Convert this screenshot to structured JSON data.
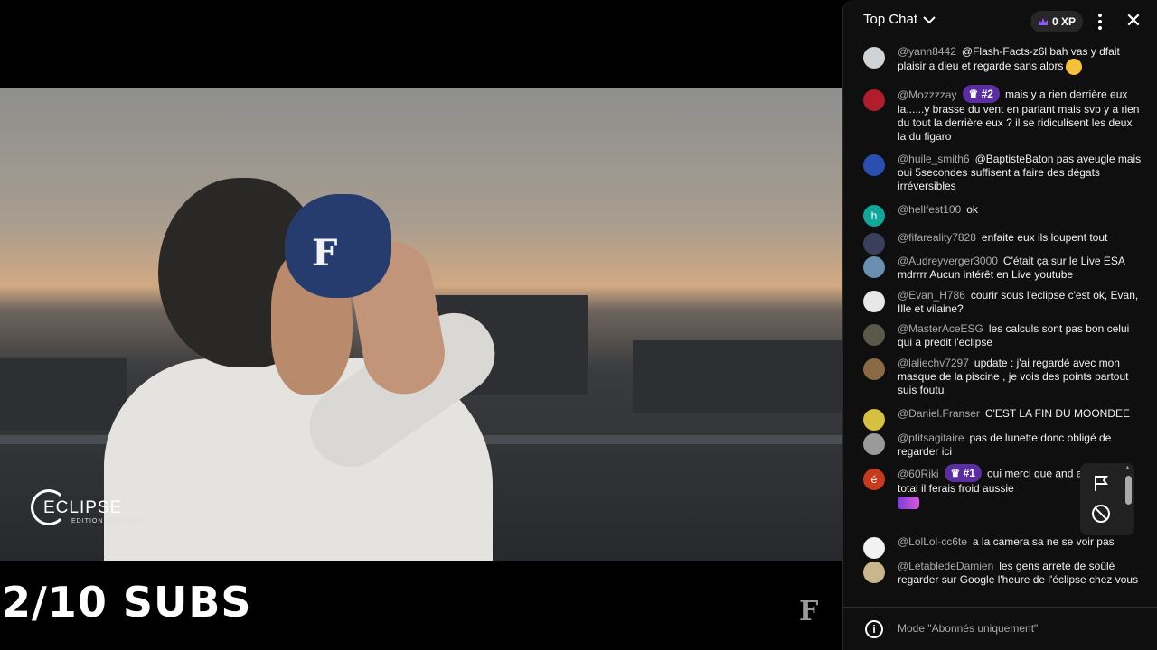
{
  "video": {
    "overlay_logo_text": "ECLIPSE",
    "overlay_logo_subtitle": "EDITION SPECIALE",
    "subs_counter": "2/10 SUBS",
    "brand_mark": "F"
  },
  "chat": {
    "title": "Top Chat",
    "xp_label": "0 XP",
    "footer_text": "Mode \"Abonnés uniquement\"",
    "messages": [
      {
        "author": "@yann8442",
        "text": "@Flash-Facts-z6l bah vas y dfait plaisir a dieu et regarde sans alors",
        "avatar_color": "#cfd3d6",
        "avatar_letter": ""
      },
      {
        "author": "@Mozzzzay",
        "rank": "#2",
        "text": "mais y a rien derrière eux la......y brasse du vent en parlant mais svp y a rien du tout la derrière eux ? il se ridiculisent les deux la du figaro",
        "avatar_color": "#b01e2e",
        "avatar_letter": ""
      },
      {
        "author": "@huile_smith6",
        "text": "@BaptisteBaton pas aveugle mais oui 5secondes suffisent a faire des dégats irréversibles",
        "avatar_color": "#2b4fb0",
        "avatar_letter": ""
      },
      {
        "author": "@hellfest100",
        "text": "ok",
        "avatar_color": "#12a69a",
        "avatar_letter": "h"
      },
      {
        "author": "@fifareality7828",
        "text": "enfaite eux ils loupent tout",
        "avatar_color": "#3a3f5c",
        "avatar_letter": ""
      },
      {
        "author": "@Audreyverger3000",
        "text": "C'était ça sur le Live ESA mdrrrr Aucun intérêt en Live youtube",
        "avatar_color": "#6a8fb0",
        "avatar_letter": ""
      },
      {
        "author": "@Evan_H786",
        "text": "courir sous l'eclipse c'est ok, Evan, Ille et vilaine?",
        "avatar_color": "#e8e8e8",
        "avatar_letter": ""
      },
      {
        "author": "@MasterAceESG",
        "text": "les calculs sont pas bon celui qui a predit l'eclipse",
        "avatar_color": "#5b5a4a",
        "avatar_letter": ""
      },
      {
        "author": "@laliechv7297",
        "text": "update : j'ai regardé avec mon masque de la piscine , je vois des points partout suis foutu",
        "avatar_color": "#8a6a44",
        "avatar_letter": ""
      },
      {
        "author": "@Daniel.Franser",
        "text": "C'EST LA FIN DU MOONDEE",
        "avatar_color": "#d6c042",
        "avatar_letter": ""
      },
      {
        "author": "@ptitsagitaire",
        "text": "pas de lunette donc obligé de regarder ici",
        "avatar_color": "#9a9a9a",
        "avatar_letter": ""
      },
      {
        "author": "@60Riki",
        "rank": "#1",
        "text": "oui merci que and aurais étais total il ferais froid aussie",
        "avatar_color": "#c73a1d",
        "avatar_letter": "é"
      },
      {
        "author": "@LolLol-cc6te",
        "text": "a la camera sa ne se voir pas",
        "avatar_color": "#f2f2f2",
        "avatar_letter": ""
      },
      {
        "author": "@LetabledeDamien",
        "text": "les gens arrete de soûlé regarder sur Google l'heure de l'éclipse chez vous",
        "avatar_color": "#c9b68a",
        "avatar_letter": ""
      }
    ]
  }
}
